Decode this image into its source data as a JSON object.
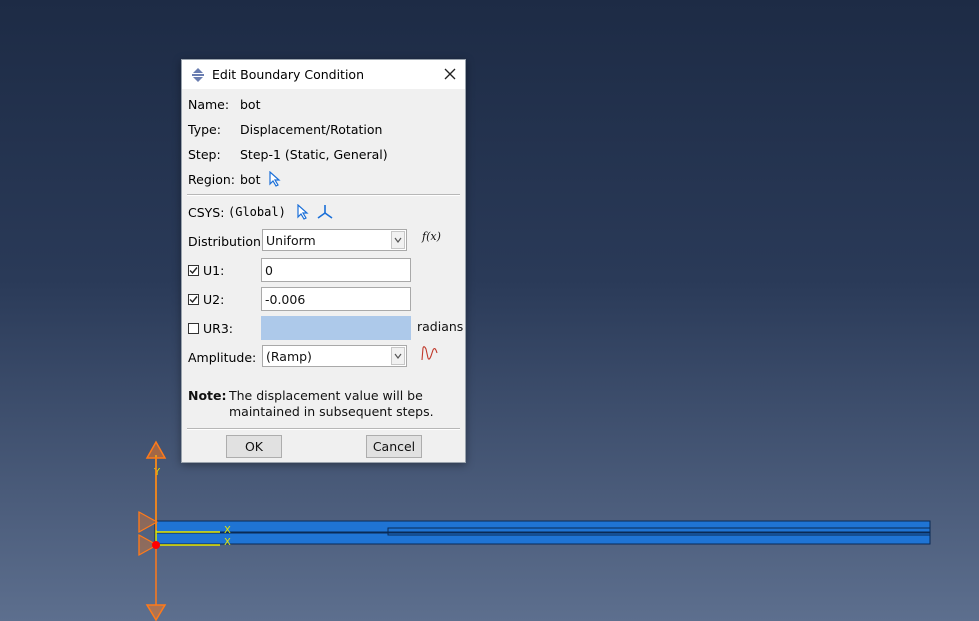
{
  "dialog": {
    "title": "Edit Boundary Condition",
    "name_label": "Name:",
    "name_value": "bot",
    "type_label": "Type:",
    "type_value": "Displacement/Rotation",
    "step_label": "Step:",
    "step_value": "Step-1 (Static, General)",
    "region_label": "Region:",
    "region_value": "bot",
    "csys_label": "CSYS:",
    "csys_value": "(Global)",
    "distribution_label": "Distribution:",
    "distribution_value": "Uniform",
    "fx_label": "f(x)",
    "u1_label": "U1:",
    "u1_value": "0",
    "u1_checked": true,
    "u2_label": "U2:",
    "u2_value": "-0.006",
    "u2_checked": true,
    "ur3_label": "UR3:",
    "ur3_value": "",
    "ur3_checked": false,
    "ur3_unit": "radians",
    "amplitude_label": "Amplitude:",
    "amplitude_value": "(Ramp)",
    "note_label": "Note:",
    "note_line1": "The displacement value will be",
    "note_line2": "maintained in subsequent steps.",
    "ok_label": "OK",
    "cancel_label": "Cancel"
  },
  "viewport": {
    "axis_y_label": "Y",
    "axis_x_label": "X"
  },
  "colors": {
    "part_blue": "#1f74d4",
    "bc_orange": "#ff7a1a",
    "axis_yellow": "#e8e800",
    "node_red": "#ff0000"
  }
}
